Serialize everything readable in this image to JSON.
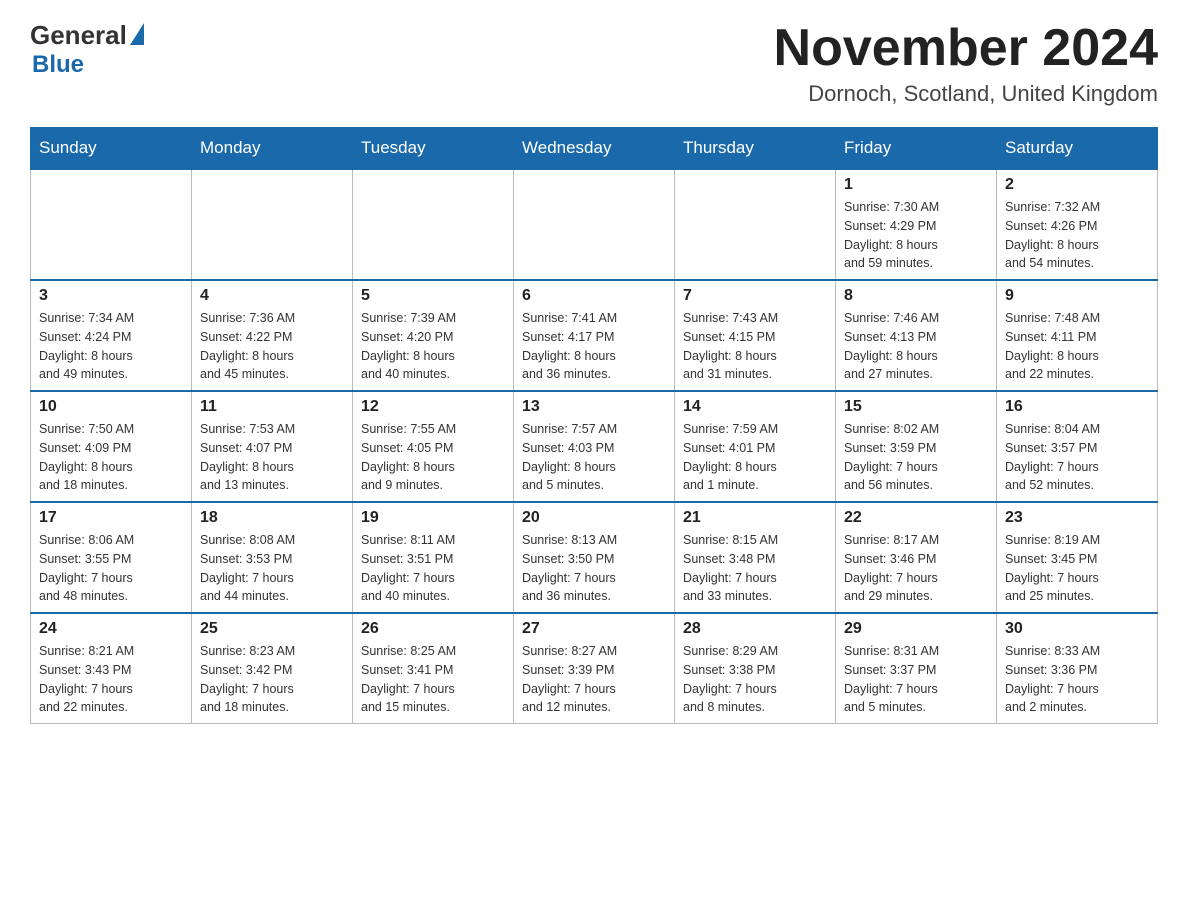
{
  "header": {
    "logo_general": "General",
    "logo_blue": "Blue",
    "month_title": "November 2024",
    "location": "Dornoch, Scotland, United Kingdom"
  },
  "days_of_week": [
    "Sunday",
    "Monday",
    "Tuesday",
    "Wednesday",
    "Thursday",
    "Friday",
    "Saturday"
  ],
  "weeks": [
    [
      {
        "day": "",
        "info": ""
      },
      {
        "day": "",
        "info": ""
      },
      {
        "day": "",
        "info": ""
      },
      {
        "day": "",
        "info": ""
      },
      {
        "day": "",
        "info": ""
      },
      {
        "day": "1",
        "info": "Sunrise: 7:30 AM\nSunset: 4:29 PM\nDaylight: 8 hours\nand 59 minutes."
      },
      {
        "day": "2",
        "info": "Sunrise: 7:32 AM\nSunset: 4:26 PM\nDaylight: 8 hours\nand 54 minutes."
      }
    ],
    [
      {
        "day": "3",
        "info": "Sunrise: 7:34 AM\nSunset: 4:24 PM\nDaylight: 8 hours\nand 49 minutes."
      },
      {
        "day": "4",
        "info": "Sunrise: 7:36 AM\nSunset: 4:22 PM\nDaylight: 8 hours\nand 45 minutes."
      },
      {
        "day": "5",
        "info": "Sunrise: 7:39 AM\nSunset: 4:20 PM\nDaylight: 8 hours\nand 40 minutes."
      },
      {
        "day": "6",
        "info": "Sunrise: 7:41 AM\nSunset: 4:17 PM\nDaylight: 8 hours\nand 36 minutes."
      },
      {
        "day": "7",
        "info": "Sunrise: 7:43 AM\nSunset: 4:15 PM\nDaylight: 8 hours\nand 31 minutes."
      },
      {
        "day": "8",
        "info": "Sunrise: 7:46 AM\nSunset: 4:13 PM\nDaylight: 8 hours\nand 27 minutes."
      },
      {
        "day": "9",
        "info": "Sunrise: 7:48 AM\nSunset: 4:11 PM\nDaylight: 8 hours\nand 22 minutes."
      }
    ],
    [
      {
        "day": "10",
        "info": "Sunrise: 7:50 AM\nSunset: 4:09 PM\nDaylight: 8 hours\nand 18 minutes."
      },
      {
        "day": "11",
        "info": "Sunrise: 7:53 AM\nSunset: 4:07 PM\nDaylight: 8 hours\nand 13 minutes."
      },
      {
        "day": "12",
        "info": "Sunrise: 7:55 AM\nSunset: 4:05 PM\nDaylight: 8 hours\nand 9 minutes."
      },
      {
        "day": "13",
        "info": "Sunrise: 7:57 AM\nSunset: 4:03 PM\nDaylight: 8 hours\nand 5 minutes."
      },
      {
        "day": "14",
        "info": "Sunrise: 7:59 AM\nSunset: 4:01 PM\nDaylight: 8 hours\nand 1 minute."
      },
      {
        "day": "15",
        "info": "Sunrise: 8:02 AM\nSunset: 3:59 PM\nDaylight: 7 hours\nand 56 minutes."
      },
      {
        "day": "16",
        "info": "Sunrise: 8:04 AM\nSunset: 3:57 PM\nDaylight: 7 hours\nand 52 minutes."
      }
    ],
    [
      {
        "day": "17",
        "info": "Sunrise: 8:06 AM\nSunset: 3:55 PM\nDaylight: 7 hours\nand 48 minutes."
      },
      {
        "day": "18",
        "info": "Sunrise: 8:08 AM\nSunset: 3:53 PM\nDaylight: 7 hours\nand 44 minutes."
      },
      {
        "day": "19",
        "info": "Sunrise: 8:11 AM\nSunset: 3:51 PM\nDaylight: 7 hours\nand 40 minutes."
      },
      {
        "day": "20",
        "info": "Sunrise: 8:13 AM\nSunset: 3:50 PM\nDaylight: 7 hours\nand 36 minutes."
      },
      {
        "day": "21",
        "info": "Sunrise: 8:15 AM\nSunset: 3:48 PM\nDaylight: 7 hours\nand 33 minutes."
      },
      {
        "day": "22",
        "info": "Sunrise: 8:17 AM\nSunset: 3:46 PM\nDaylight: 7 hours\nand 29 minutes."
      },
      {
        "day": "23",
        "info": "Sunrise: 8:19 AM\nSunset: 3:45 PM\nDaylight: 7 hours\nand 25 minutes."
      }
    ],
    [
      {
        "day": "24",
        "info": "Sunrise: 8:21 AM\nSunset: 3:43 PM\nDaylight: 7 hours\nand 22 minutes."
      },
      {
        "day": "25",
        "info": "Sunrise: 8:23 AM\nSunset: 3:42 PM\nDaylight: 7 hours\nand 18 minutes."
      },
      {
        "day": "26",
        "info": "Sunrise: 8:25 AM\nSunset: 3:41 PM\nDaylight: 7 hours\nand 15 minutes."
      },
      {
        "day": "27",
        "info": "Sunrise: 8:27 AM\nSunset: 3:39 PM\nDaylight: 7 hours\nand 12 minutes."
      },
      {
        "day": "28",
        "info": "Sunrise: 8:29 AM\nSunset: 3:38 PM\nDaylight: 7 hours\nand 8 minutes."
      },
      {
        "day": "29",
        "info": "Sunrise: 8:31 AM\nSunset: 3:37 PM\nDaylight: 7 hours\nand 5 minutes."
      },
      {
        "day": "30",
        "info": "Sunrise: 8:33 AM\nSunset: 3:36 PM\nDaylight: 7 hours\nand 2 minutes."
      }
    ]
  ]
}
